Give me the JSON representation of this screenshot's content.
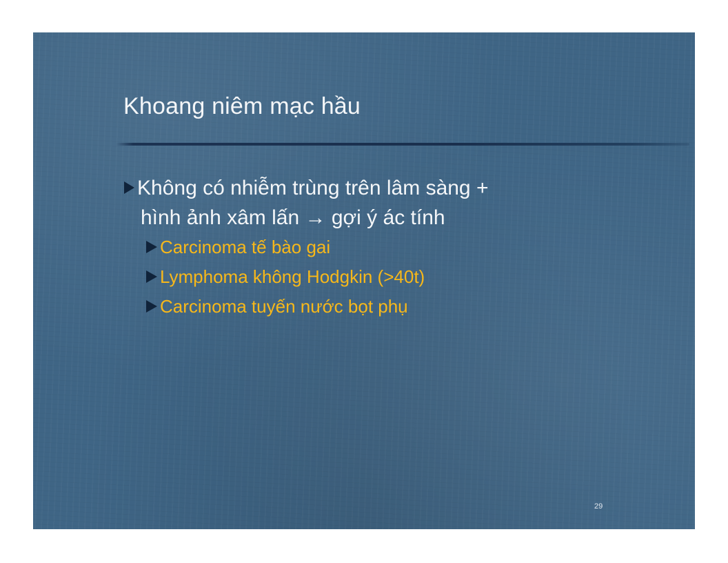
{
  "slide": {
    "title": "Khoang niêm mạc hầu",
    "main_bullet": {
      "line1": "Không có nhiễm trùng trên lâm sàng +",
      "line2": "hình ảnh xâm lấn → gợi ý ác tính"
    },
    "sub_bullets": [
      "Carcinoma tế bào gai",
      "Lymphoma không Hodgkin (>40t)",
      "Carcinoma tuyến nước bọt phụ"
    ],
    "page_number": "29"
  },
  "colors": {
    "background": "#3f6585",
    "title_text": "#f4f6f8",
    "sub_bullet_text": "#f7b81a",
    "bullet_marker": "#10233a"
  },
  "icons": {
    "bullet": "triangle-right-icon"
  }
}
